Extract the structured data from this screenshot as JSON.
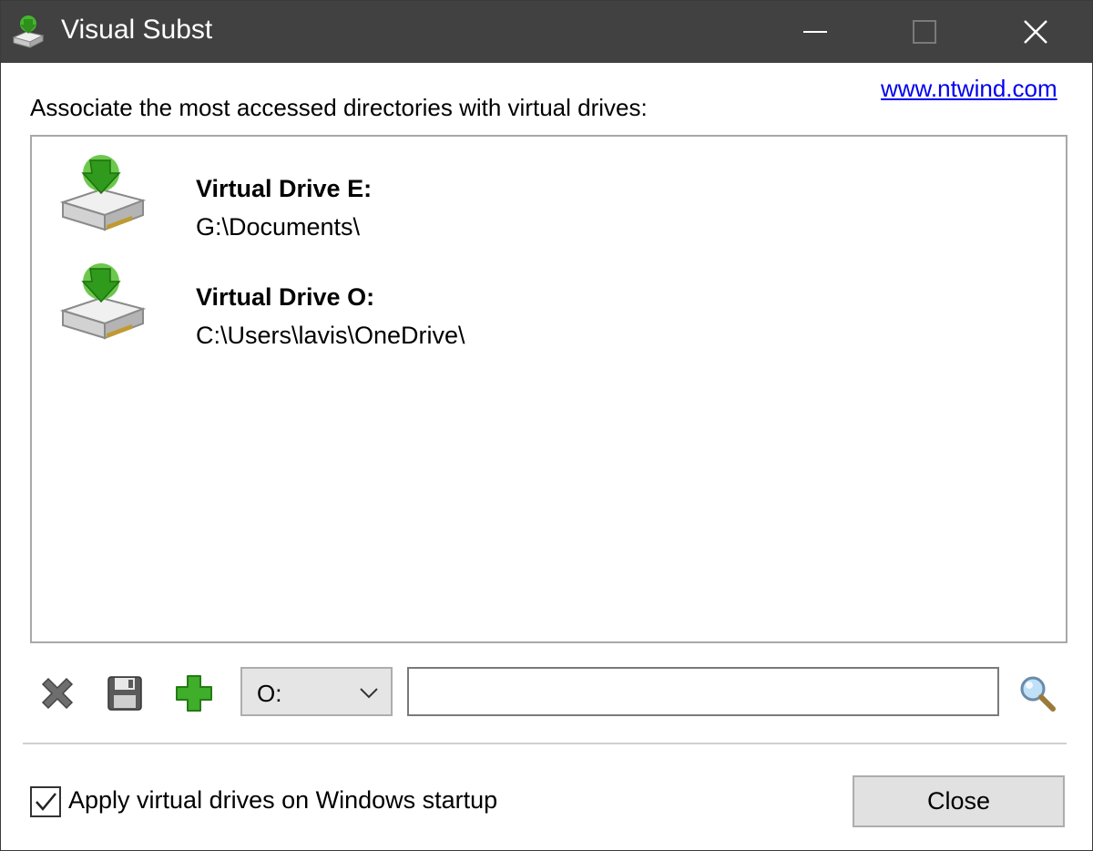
{
  "window": {
    "title": "Visual Subst",
    "icons": {
      "app": "drive-icon",
      "minimize": "minimize-icon",
      "maximize": "maximize-icon",
      "close": "close-icon"
    }
  },
  "header": {
    "website_link": "www.ntwind.com",
    "instruction": "Associate the most accessed directories with virtual drives:"
  },
  "drives": [
    {
      "name": "Virtual Drive E:",
      "path": "G:\\Documents\\"
    },
    {
      "name": "Virtual Drive O:",
      "path": "C:\\Users\\lavis\\OneDrive\\"
    }
  ],
  "toolbar": {
    "delete_icon": "delete-x-icon",
    "save_icon": "floppy-disk-icon",
    "add_icon": "green-plus-icon",
    "drive_letter_selected": "O:",
    "path_value": "",
    "browse_icon": "magnifier-icon"
  },
  "footer": {
    "startup_label": "Apply virtual drives on Windows startup",
    "startup_checked": true,
    "close_label": "Close"
  },
  "colors": {
    "titlebar": "#414141",
    "link": "#0000ee",
    "accent_green": "#3fae2a"
  }
}
